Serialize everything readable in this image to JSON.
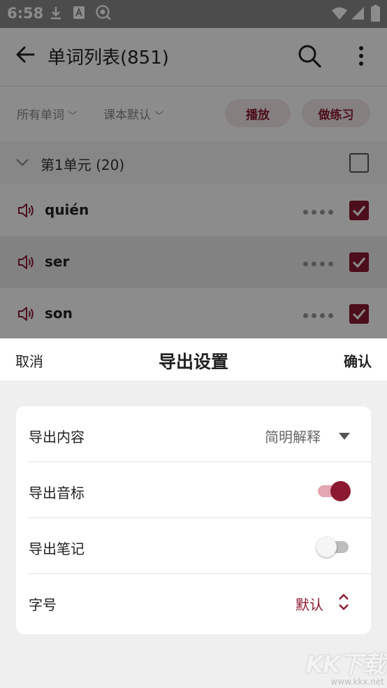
{
  "status_bar": {
    "time": "6:58"
  },
  "toolbar": {
    "title": "单词列表(851)"
  },
  "filters": {
    "scope": "所有单词",
    "order": "课本默认",
    "play_label": "播放",
    "practice_label": "做练习"
  },
  "unit": {
    "title": "第1单元 (20)",
    "checked": false
  },
  "words": [
    {
      "text": "quién",
      "checked": true
    },
    {
      "text": "ser",
      "checked": true
    },
    {
      "text": "son",
      "checked": true
    }
  ],
  "sheet": {
    "cancel_label": "取消",
    "title": "导出设置",
    "confirm_label": "确认",
    "options": {
      "content": {
        "label": "导出内容",
        "value": "简明解释"
      },
      "phonetic": {
        "label": "导出音标",
        "enabled": true
      },
      "notes": {
        "label": "导出笔记",
        "enabled": false
      },
      "font_size": {
        "label": "字号",
        "value": "默认"
      }
    }
  },
  "watermark": {
    "logo": "KK下载",
    "url": "www.kkx.net"
  },
  "colors": {
    "accent": "#8b1a30",
    "accent_light": "#e3a6b2"
  }
}
